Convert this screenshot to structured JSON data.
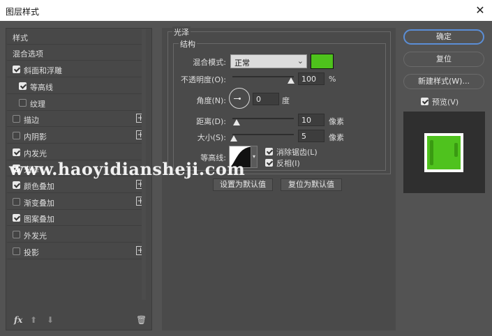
{
  "window": {
    "title": "图层样式",
    "close_glyph": "✕"
  },
  "sidebar": {
    "items": [
      {
        "label": "样式",
        "checkbox": null,
        "plus": false
      },
      {
        "label": "混合选项",
        "checkbox": null,
        "plus": false
      },
      {
        "label": "斜面和浮雕",
        "checkbox": true,
        "plus": false
      },
      {
        "label": "等高线",
        "checkbox": true,
        "plus": false,
        "indent": true
      },
      {
        "label": "纹理",
        "checkbox": false,
        "plus": false,
        "indent": true
      },
      {
        "label": "描边",
        "checkbox": false,
        "plus": true
      },
      {
        "label": "内阴影",
        "checkbox": false,
        "plus": true
      },
      {
        "label": "内发光",
        "checkbox": true,
        "plus": false
      },
      {
        "label": "光泽",
        "checkbox": true,
        "plus": false
      },
      {
        "label": "颜色叠加",
        "checkbox": true,
        "plus": true
      },
      {
        "label": "渐变叠加",
        "checkbox": false,
        "plus": true
      },
      {
        "label": "图案叠加",
        "checkbox": true,
        "plus": false
      },
      {
        "label": "外发光",
        "checkbox": false,
        "plus": false
      },
      {
        "label": "投影",
        "checkbox": false,
        "plus": true
      }
    ],
    "footer_icons": [
      "fx-icon",
      "arrow-up-icon",
      "arrow-down-icon",
      "trash-icon"
    ],
    "fx_label": "fx"
  },
  "section": {
    "title": "光泽",
    "group_title": "结构",
    "blend_mode_label": "混合模式:",
    "blend_mode_value": "正常",
    "blend_color": "#4ec21c",
    "opacity_label": "不透明度(O):",
    "opacity_value": "100",
    "opacity_unit": "%",
    "angle_label": "角度(N):",
    "angle_value": "0",
    "angle_unit": "度",
    "distance_label": "距离(D):",
    "distance_value": "10",
    "distance_unit": "像素",
    "size_label": "大小(S):",
    "size_value": "5",
    "size_unit": "像素",
    "contour_label": "等高线:",
    "antialias_label": "消除锯齿(L)",
    "antialias_checked": true,
    "invert_label": "反相(I)",
    "invert_checked": true,
    "set_default_label": "设置为默认值",
    "reset_default_label": "复位为默认值"
  },
  "actions": {
    "ok_label": "确定",
    "reset_label": "复位",
    "new_style_label": "新建样式(W)...",
    "preview_label": "预览(V)",
    "preview_checked": true
  },
  "watermark": {
    "text": "www.haoyidiansheji.com"
  }
}
